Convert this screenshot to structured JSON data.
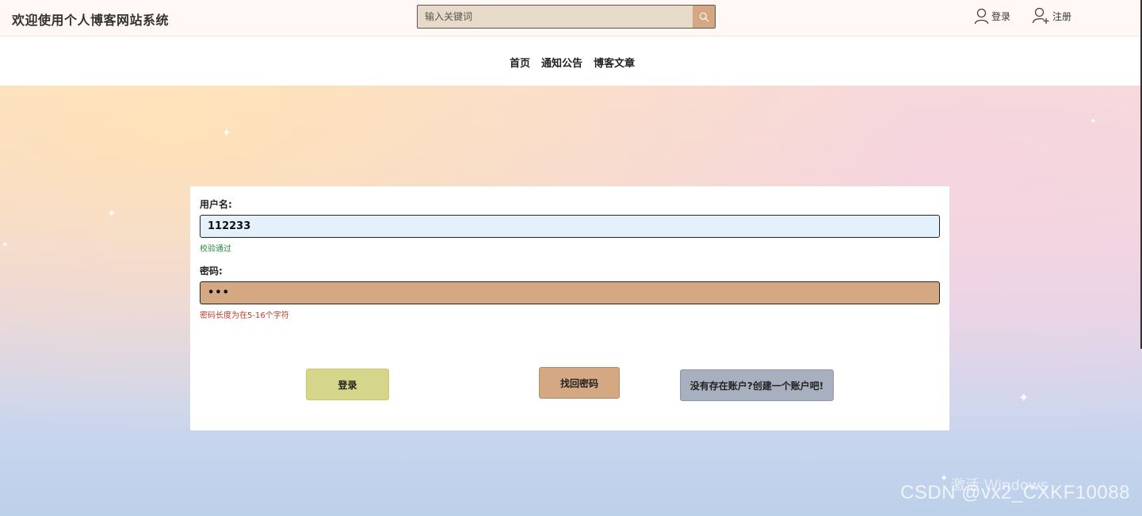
{
  "header": {
    "site_title": "欢迎使用个人博客网站系统",
    "search_placeholder": "输入关键词",
    "login_label": "登录",
    "register_label": "注册"
  },
  "nav": {
    "items": [
      "首页",
      "通知公告",
      "博客文章"
    ]
  },
  "form": {
    "username_label": "用户名:",
    "username_value": "112233",
    "username_hint": "校验通过",
    "password_label": "密码:",
    "password_value": "•••",
    "password_hint": "密码长度为在5-16个字符",
    "login_button": "登录",
    "forgot_button": "找回密码",
    "register_button": "没有存在账户?创建一个账户吧!"
  },
  "overlay": {
    "activate_windows": "激活 Windows",
    "watermark": "CSDN @vx2_CXKF10088"
  },
  "colors": {
    "search_button": "#d4a882",
    "username_bg": "#e5f0fd",
    "password_bg": "#d4a882",
    "login_button": "#d6d68a",
    "forgot_button": "#d4a882",
    "register_button": "#a8b0c0",
    "hint_ok": "#2a8a3a",
    "hint_err": "#c0392b"
  }
}
